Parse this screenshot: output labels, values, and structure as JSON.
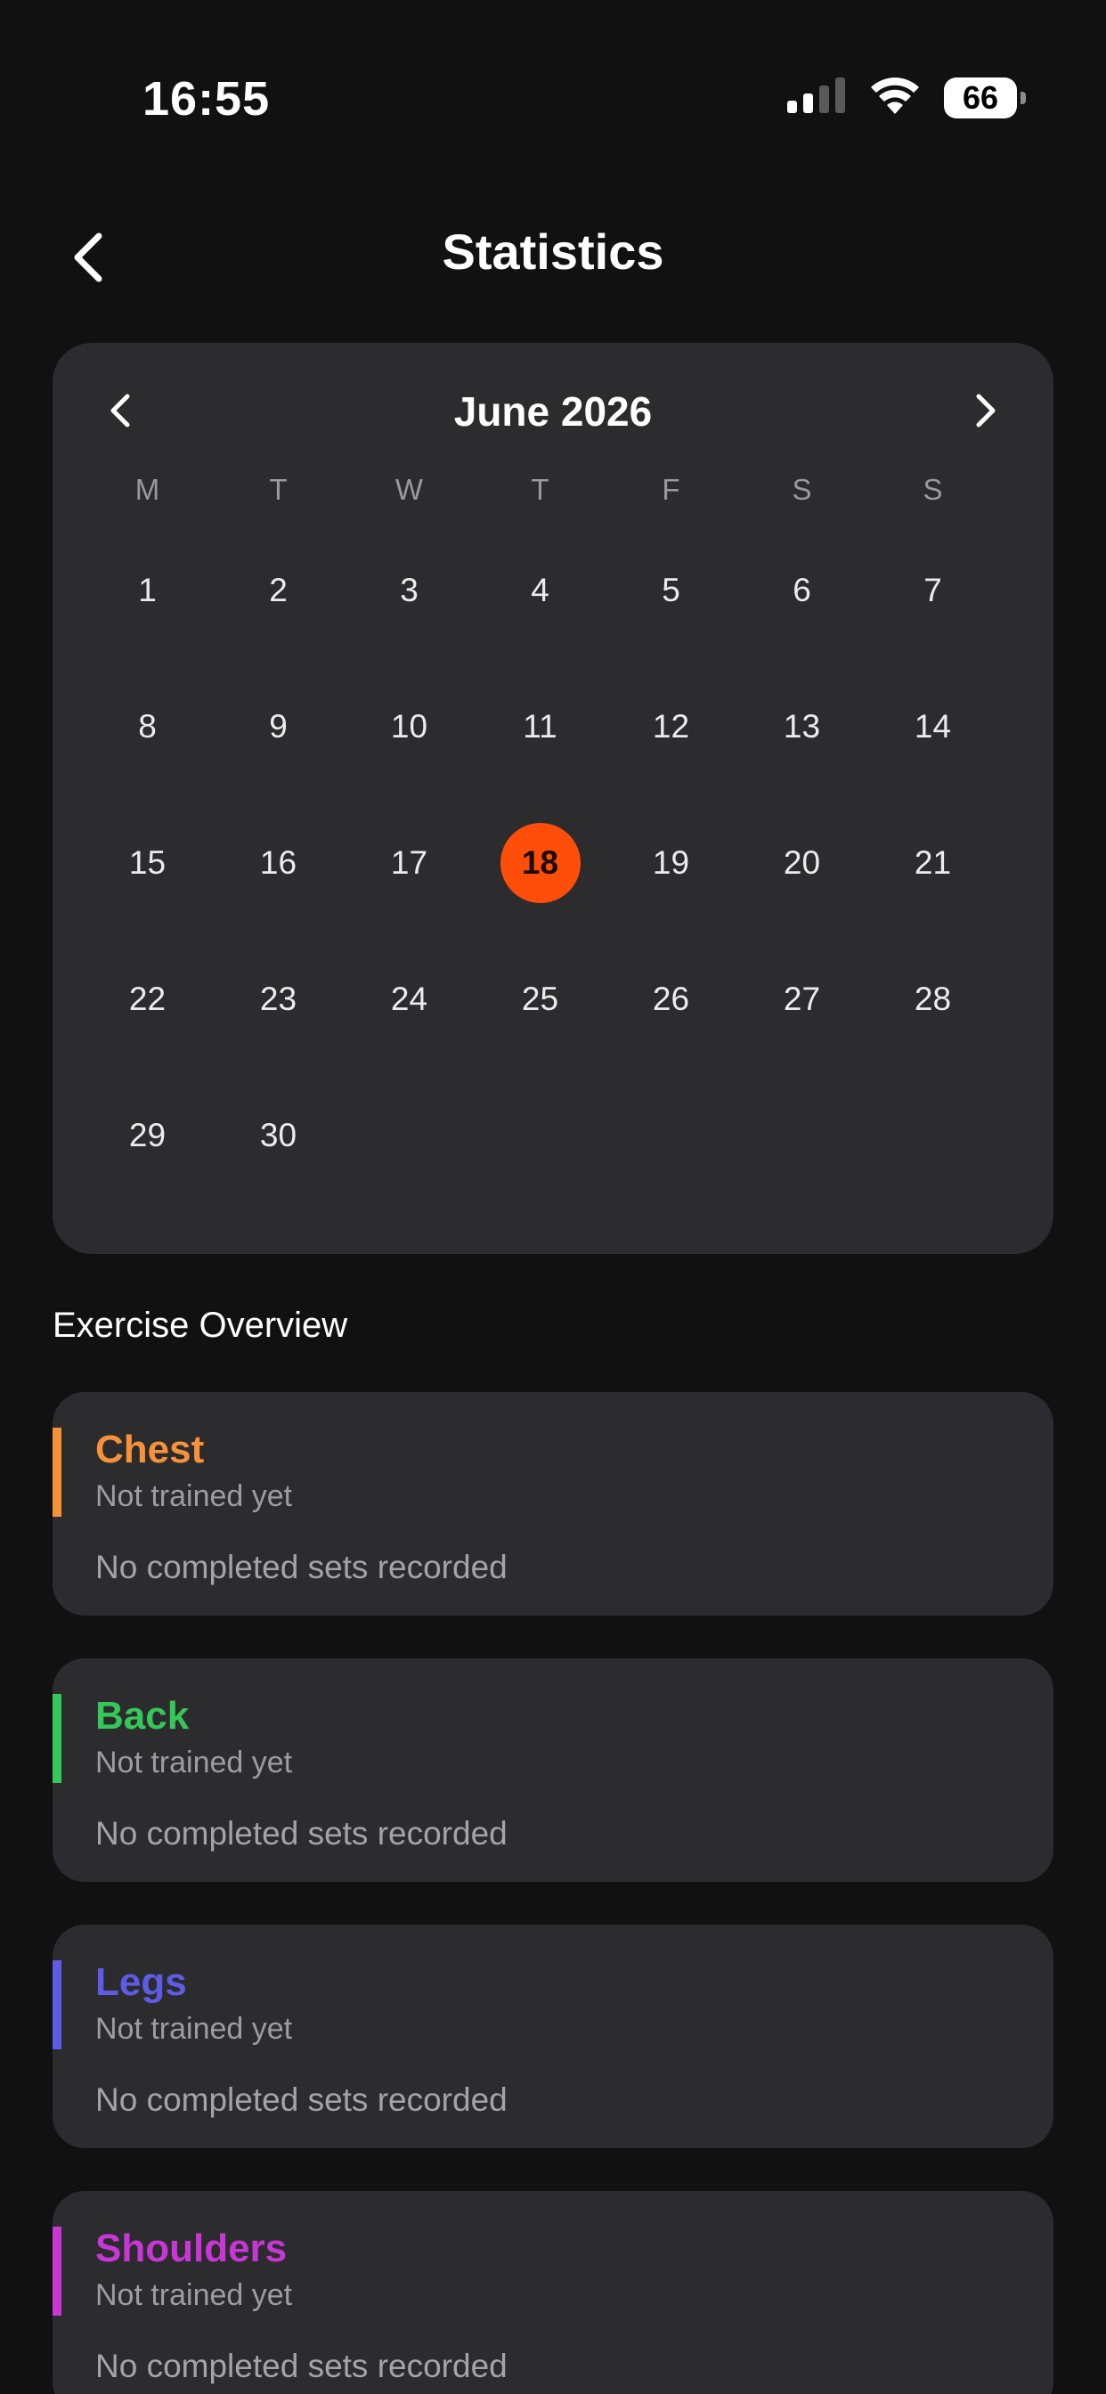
{
  "status_bar": {
    "time": "16:55",
    "battery": "66",
    "icons": [
      "cellular-signal-icon",
      "wifi-icon",
      "battery-icon"
    ]
  },
  "header": {
    "title": "Statistics",
    "back_icon": "chevron-left-icon"
  },
  "calendar": {
    "month_label": "June 2026",
    "prev_icon": "chevron-left-icon",
    "next_icon": "chevron-right-icon",
    "weekdays": [
      "M",
      "T",
      "W",
      "T",
      "F",
      "S",
      "S"
    ],
    "weeks": [
      [
        "1",
        "2",
        "3",
        "4",
        "5",
        "6",
        "7"
      ],
      [
        "8",
        "9",
        "10",
        "11",
        "12",
        "13",
        "14"
      ],
      [
        "15",
        "16",
        "17",
        "18",
        "19",
        "20",
        "21"
      ],
      [
        "22",
        "23",
        "24",
        "25",
        "26",
        "27",
        "28"
      ],
      [
        "29",
        "30",
        "",
        "",
        "",
        "",
        ""
      ]
    ],
    "selected_day": "18",
    "selected_color": "#ff4d0a"
  },
  "overview": {
    "title": "Exercise Overview",
    "exercises": [
      {
        "name": "Chest",
        "status": "Not trained yet",
        "sets": "No completed sets recorded",
        "color": "#f7913a"
      },
      {
        "name": "Back",
        "status": "Not trained yet",
        "sets": "No completed sets recorded",
        "color": "#35c759"
      },
      {
        "name": "Legs",
        "status": "Not trained yet",
        "sets": "No completed sets recorded",
        "color": "#5e5ce6"
      },
      {
        "name": "Shoulders",
        "status": "Not trained yet",
        "sets": "No completed sets recorded",
        "color": "#c936d6"
      }
    ]
  }
}
